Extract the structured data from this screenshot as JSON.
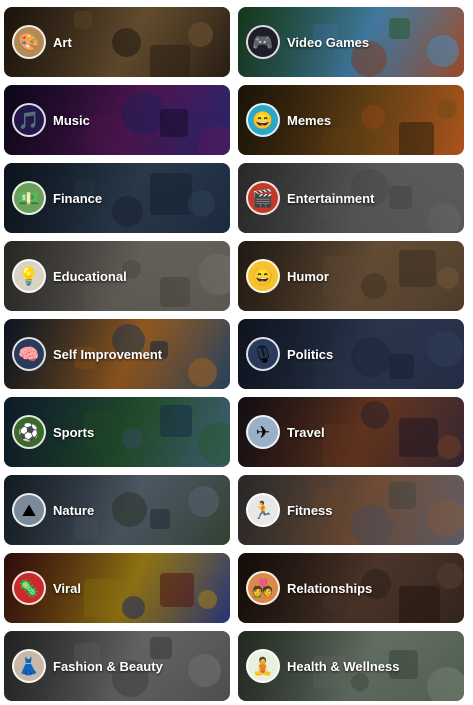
{
  "categories": [
    {
      "label": "Art",
      "icon": "palette-icon",
      "glyph": "🎨",
      "bg": [
        "#3b2a1c",
        "#8a6a3f",
        "#2c2117"
      ],
      "avatar_bg": "#b48b57"
    },
    {
      "label": "Video Games",
      "icon": "gamepad-icon",
      "glyph": "🎮",
      "bg": [
        "#2d7a38",
        "#5aa9e0",
        "#b5542c"
      ],
      "avatar_bg": "#1e1e2a"
    },
    {
      "label": "Music",
      "icon": "music-note-icon",
      "glyph": "🎵",
      "bg": [
        "#1a0f3a",
        "#6b1e6e",
        "#2a2a7a"
      ],
      "avatar_bg": "#22184a"
    },
    {
      "label": "Memes",
      "icon": "meme-face-icon",
      "glyph": "😄",
      "bg": [
        "#3b2a12",
        "#8a5a1c",
        "#c9621f"
      ],
      "avatar_bg": "#2aa7c9"
    },
    {
      "label": "Finance",
      "icon": "money-icon",
      "glyph": "💵",
      "bg": [
        "#1a2a3e",
        "#3a5068",
        "#20304a"
      ],
      "avatar_bg": "#6aa05a"
    },
    {
      "label": "Entertainment",
      "icon": "entertainment-icon",
      "glyph": "🎬",
      "bg": [
        "#5a5a5a",
        "#7a7a7a",
        "#666666"
      ],
      "avatar_bg": "#c23a2a"
    },
    {
      "label": "Educational",
      "icon": "lightbulb-icon",
      "glyph": "💡",
      "bg": [
        "#5a5650",
        "#8a857c",
        "#6a665e"
      ],
      "avatar_bg": "#d9d3c6"
    },
    {
      "label": "Humor",
      "icon": "laughing-face-icon",
      "glyph": "😄",
      "bg": [
        "#4a3a2a",
        "#8a6a4a",
        "#5a4632"
      ],
      "avatar_bg": "#f4c430"
    },
    {
      "label": "Self Improvement",
      "icon": "growth-icon",
      "glyph": "🧠",
      "bg": [
        "#1a2e4a",
        "#c97a2a",
        "#2a4a6e"
      ],
      "avatar_bg": "#2a3a5a"
    },
    {
      "label": "Politics",
      "icon": "politician-icon",
      "glyph": "🎙",
      "bg": [
        "#1e2a44",
        "#3a4a6a",
        "#2a3350"
      ],
      "avatar_bg": "#2a3a5a"
    },
    {
      "label": "Sports",
      "icon": "soccer-ball-icon",
      "glyph": "⚽",
      "bg": [
        "#1e3a5a",
        "#2f6a3a",
        "#4a6a8a"
      ],
      "avatar_bg": "#3a6a2a"
    },
    {
      "label": "Travel",
      "icon": "airplane-icon",
      "glyph": "✈",
      "bg": [
        "#2a1e2a",
        "#8a4a2a",
        "#3a2a3a"
      ],
      "avatar_bg": "#9ab0c8"
    },
    {
      "label": "Nature",
      "icon": "mountain-icon",
      "glyph": "⛰",
      "bg": [
        "#2a3a4a",
        "#6a7a8a",
        "#3a4a3a"
      ],
      "avatar_bg": "#7a8a9a"
    },
    {
      "label": "Fitness",
      "icon": "runner-icon",
      "glyph": "🏃",
      "bg": [
        "#5a5a5a",
        "#9a6a4a",
        "#6a6a7a"
      ],
      "avatar_bg": "#e8e8e8"
    },
    {
      "label": "Viral",
      "icon": "virus-icon",
      "glyph": "🦠",
      "bg": [
        "#6a1a1a",
        "#c9a01a",
        "#2a3a8a"
      ],
      "avatar_bg": "#c92a2a"
    },
    {
      "label": "Relationships",
      "icon": "couple-icon",
      "glyph": "💑",
      "bg": [
        "#2a1a14",
        "#6a4a3a",
        "#3a2a20"
      ],
      "avatar_bg": "#d98a4a"
    },
    {
      "label": "Fashion & Beauty",
      "icon": "fashion-icon",
      "glyph": "👗",
      "bg": [
        "#4a4a4a",
        "#8a8a8a",
        "#5a5a5a"
      ],
      "avatar_bg": "#c9b8a8"
    },
    {
      "label": "Health & Wellness",
      "icon": "meditation-icon",
      "glyph": "🧘",
      "bg": [
        "#4a5a4a",
        "#8a9a8a",
        "#5a6a5a"
      ],
      "avatar_bg": "#e8f0e0"
    }
  ]
}
